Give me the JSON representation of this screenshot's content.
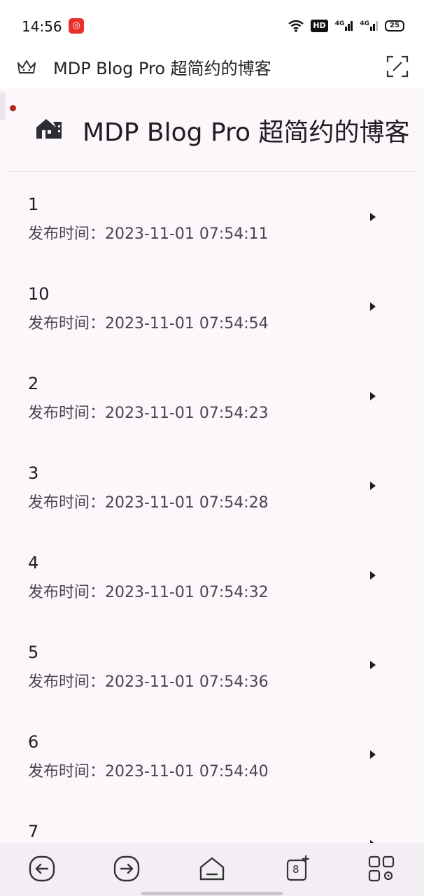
{
  "status_bar": {
    "time": "14:56",
    "notification_icon": "netease-music-icon",
    "hd_label": "HD",
    "signal_1": "4G",
    "signal_2": "4G",
    "battery": "25"
  },
  "browser_bar": {
    "title": "MDP Blog Pro 超简约的博客",
    "left_icon": "crown-icon",
    "right_icon": "expand-icon"
  },
  "page": {
    "title": "MDP Blog Pro 超简约的博客",
    "logo_icon": "home-icon"
  },
  "posts": [
    {
      "title": "1",
      "date": "发布时间：2023-11-01 07:54:11"
    },
    {
      "title": "10",
      "date": "发布时间：2023-11-01 07:54:54"
    },
    {
      "title": "2",
      "date": "发布时间：2023-11-01 07:54:23"
    },
    {
      "title": "3",
      "date": "发布时间：2023-11-01 07:54:28"
    },
    {
      "title": "4",
      "date": "发布时间：2023-11-01 07:54:32"
    },
    {
      "title": "5",
      "date": "发布时间：2023-11-01 07:54:36"
    },
    {
      "title": "6",
      "date": "发布时间：2023-11-01 07:54:40"
    },
    {
      "title": "7",
      "date": ""
    }
  ],
  "bottom_nav": {
    "back_icon": "back-icon",
    "forward_icon": "forward-icon",
    "home_icon": "home-icon",
    "tabs_count": "8",
    "menu_icon": "apps-icon"
  }
}
